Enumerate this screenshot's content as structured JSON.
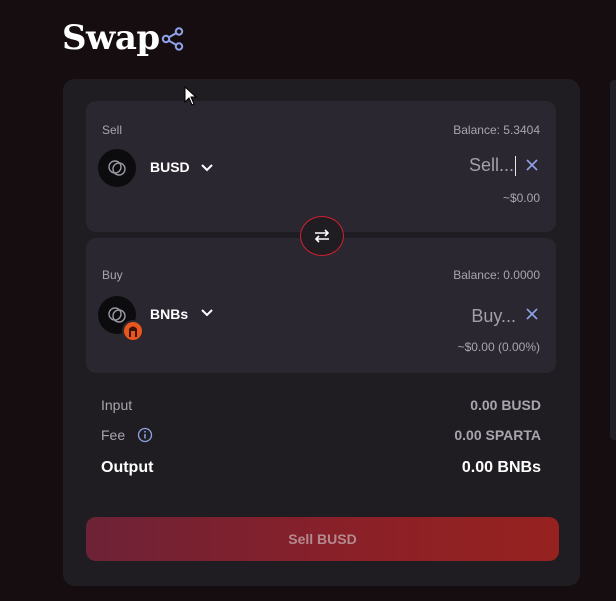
{
  "header": {
    "title": "Swap",
    "share_icon": "share-icon"
  },
  "sell": {
    "label": "Sell",
    "balance": "Balance: 5.3404",
    "token": "BUSD",
    "placeholder": "Sell...",
    "usd": "~$0.00"
  },
  "buy": {
    "label": "Buy",
    "balance": "Balance: 0.0000",
    "token": "BNBs",
    "placeholder": "Buy...",
    "usd": "~$0.00 (0.00%)"
  },
  "summary": {
    "input_label": "Input",
    "input_value": "0.00 BUSD",
    "fee_label": "Fee",
    "fee_value": "0.00 SPARTA",
    "output_label": "Output",
    "output_value": "0.00 BNBs"
  },
  "action": {
    "button_label": "Sell BUSD"
  },
  "colors": {
    "accent": "#d0202f",
    "background": "#150d10",
    "card": "#1f1c22",
    "panel": "#2a2730"
  }
}
